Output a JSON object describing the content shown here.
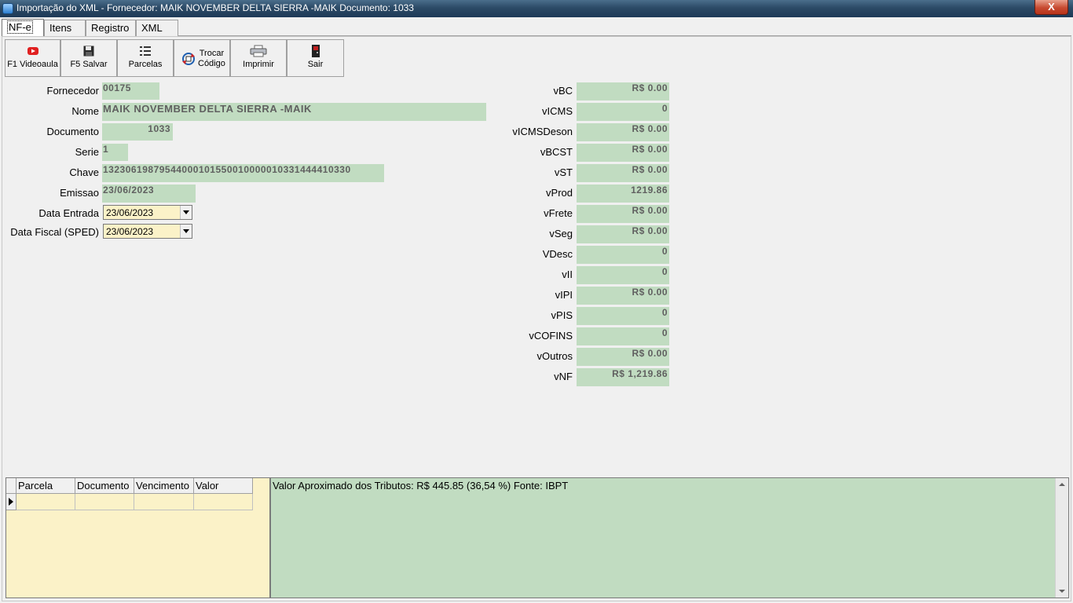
{
  "window": {
    "title": "Importação do XML - Fornecedor: MAIK NOVEMBER DELTA SIERRA -MAIK Documento: 1033",
    "close_label": "X"
  },
  "tabs": [
    {
      "label": "NF-e"
    },
    {
      "label": "Itens"
    },
    {
      "label": "Registro"
    },
    {
      "label": "XML"
    }
  ],
  "toolbar": {
    "videoaula": "F1 Videoaula",
    "salvar": "F5 Salvar",
    "parcelas": "Parcelas",
    "trocar_1": "Trocar",
    "trocar_2": "Código",
    "imprimir": "Imprimir",
    "sair": "Sair"
  },
  "form": {
    "fornecedor": {
      "label": "Fornecedor",
      "value": "00175"
    },
    "nome": {
      "label": "Nome",
      "value": "MAIK NOVEMBER DELTA SIERRA -MAIK"
    },
    "documento": {
      "label": "Documento",
      "value": "1033"
    },
    "serie": {
      "label": "Serie",
      "value": "1"
    },
    "chave": {
      "label": "Chave",
      "value": "13230619879544000101550010000010331444410330"
    },
    "emissao": {
      "label": "Emissao",
      "value": "23/06/2023"
    },
    "data_entrada": {
      "label": "Data Entrada",
      "value": "23/06/2023"
    },
    "data_fiscal": {
      "label": "Data Fiscal (SPED)",
      "value": "23/06/2023"
    }
  },
  "totals": [
    {
      "label": "vBC",
      "value": "R$ 0.00"
    },
    {
      "label": "vICMS",
      "value": "0"
    },
    {
      "label": "vICMSDeson",
      "value": "R$ 0.00"
    },
    {
      "label": "vBCST",
      "value": "R$ 0.00"
    },
    {
      "label": "vST",
      "value": "R$ 0.00"
    },
    {
      "label": "vProd",
      "value": "1219.86"
    },
    {
      "label": "vFrete",
      "value": "R$ 0.00"
    },
    {
      "label": "vSeg",
      "value": "R$ 0.00"
    },
    {
      "label": "VDesc",
      "value": "0"
    },
    {
      "label": "vII",
      "value": "0"
    },
    {
      "label": "vIPI",
      "value": "R$ 0.00"
    },
    {
      "label": "vPIS",
      "value": "0"
    },
    {
      "label": "vCOFINS",
      "value": "0"
    },
    {
      "label": "vOutros",
      "value": "R$ 0.00"
    },
    {
      "label": "vNF",
      "value": "R$ 1,219.86"
    }
  ],
  "grid": {
    "columns": [
      "Parcela",
      "Documento",
      "Vencimento",
      "Valor"
    ]
  },
  "memo": {
    "text": "Valor Aproximado dos Tributos: R$ 445.85 (36,54 %) Fonte: IBPT"
  },
  "colors": {
    "field_bg": "#c1dcc1",
    "grid_bg": "#fbf2c8",
    "close": "#c74a30"
  }
}
